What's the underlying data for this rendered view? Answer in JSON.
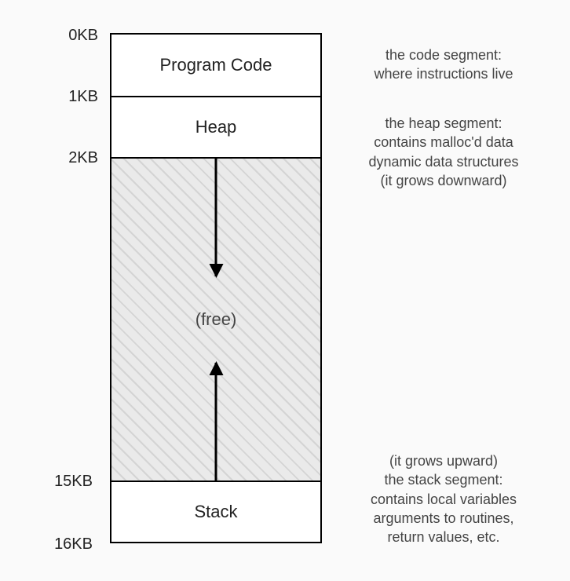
{
  "addresses": {
    "a0": "0KB",
    "a1": "1KB",
    "a2": "2KB",
    "a15": "15KB",
    "a16": "16KB"
  },
  "segments": {
    "code": "Program Code",
    "heap": "Heap",
    "free": "(free)",
    "stack": "Stack"
  },
  "descriptions": {
    "code_l1": "the code segment:",
    "code_l2": "where instructions live",
    "heap_l1": "the heap segment:",
    "heap_l2": "contains malloc'd data",
    "heap_l3": "dynamic data structures",
    "heap_l4": "(it grows downward)",
    "stack_l1": "(it grows upward)",
    "stack_l2": "the stack segment:",
    "stack_l3": "contains local variables",
    "stack_l4": "arguments to routines,",
    "stack_l5": "return values, etc."
  }
}
